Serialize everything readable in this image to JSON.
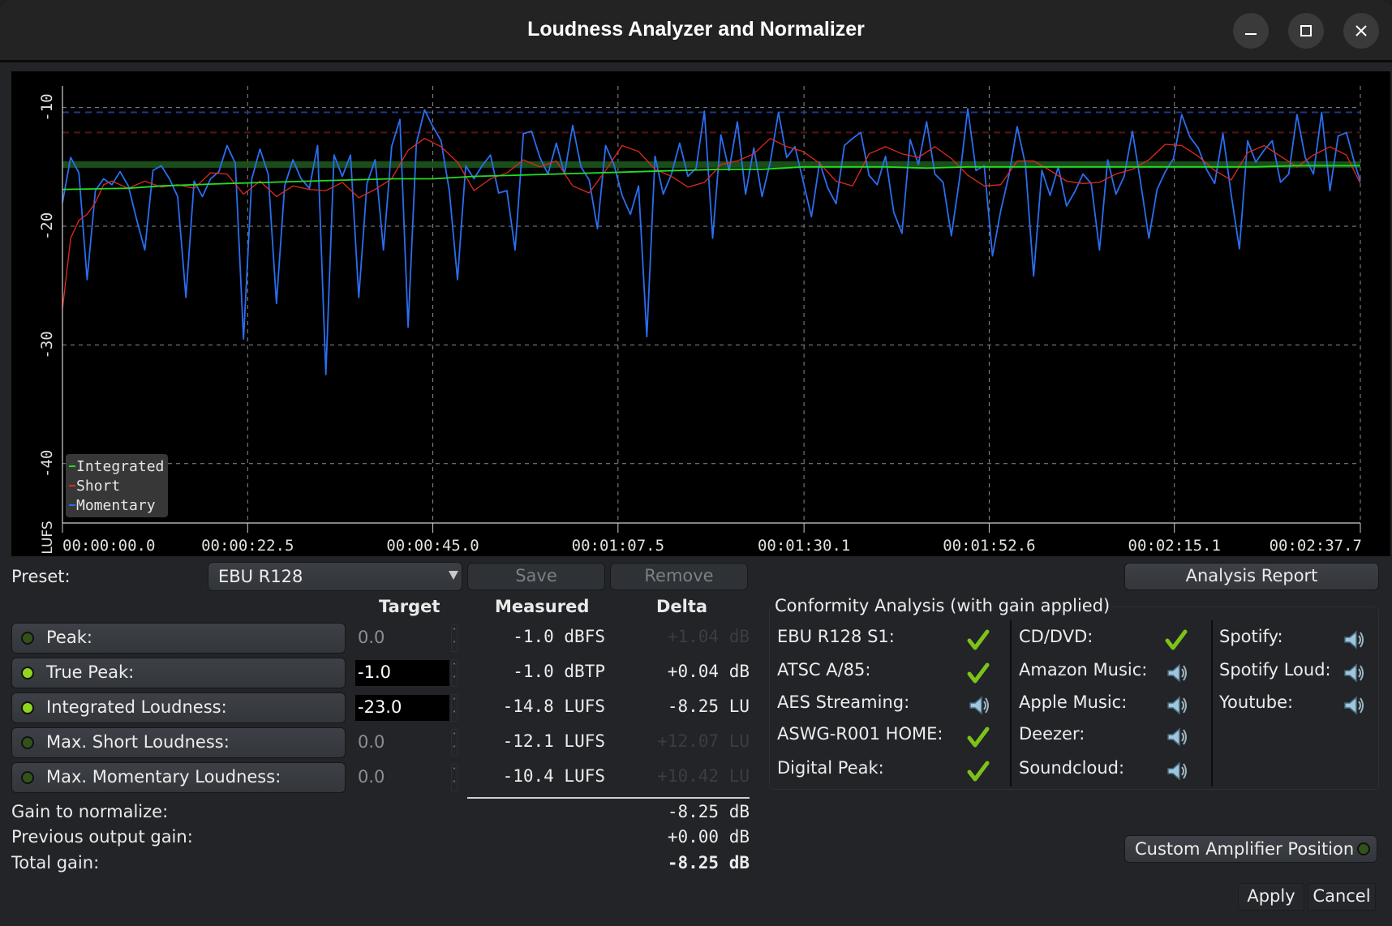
{
  "window": {
    "title": "Loudness Analyzer and Normalizer",
    "controls": [
      "minimize",
      "maximize",
      "close"
    ]
  },
  "chart_data": {
    "type": "line",
    "title": "",
    "ylabel": "LUFS",
    "xlabel": "",
    "ylim": [
      -45,
      -9
    ],
    "yticks": [
      -10,
      -20,
      -30,
      -40
    ],
    "ytick_labels": [
      "-10",
      "-20",
      "-30",
      "-40"
    ],
    "xlim_seconds": [
      0,
      157.7
    ],
    "xticks_seconds": [
      0,
      22.5,
      45.0,
      67.5,
      90.1,
      112.6,
      135.1,
      157.7
    ],
    "xtick_labels": [
      "00:00:00.0",
      "00:00:22.5",
      "00:00:45.0",
      "00:01:07.5",
      "00:01:30.1",
      "00:01:52.6",
      "00:02:15.1",
      "00:02:37.7"
    ],
    "grid": true,
    "legend": {
      "position": "bottom-left",
      "entries": [
        "Integrated",
        "Short",
        "Momentary"
      ]
    },
    "reference_lines": [
      {
        "name": "Max Momentary",
        "value": -10.4,
        "color": "#1a3a8a",
        "style": "dashed"
      },
      {
        "name": "Max Short",
        "value": -12.1,
        "color": "#5a1414",
        "style": "dashed"
      },
      {
        "name": "Integrated measured band",
        "value": -14.8,
        "color": "#1f5a1f",
        "style": "band"
      }
    ],
    "series": [
      {
        "name": "Integrated",
        "color": "#22dd22",
        "x": [
          0,
          8,
          12,
          16,
          20,
          25,
          30,
          35,
          40,
          45,
          50,
          55,
          60,
          65,
          70,
          75,
          80,
          85,
          90,
          95,
          100,
          105,
          110,
          115,
          120,
          125,
          130,
          135,
          140,
          145,
          150,
          157.7
        ],
        "values": [
          -16.9,
          -16.8,
          -16.6,
          -16.5,
          -16.4,
          -16.3,
          -16.2,
          -16.1,
          -16.0,
          -16.0,
          -15.8,
          -15.7,
          -15.6,
          -15.5,
          -15.4,
          -15.3,
          -15.2,
          -15.2,
          -15.0,
          -15.0,
          -15.0,
          -15.1,
          -15.0,
          -15.0,
          -15.0,
          -15.0,
          -15.0,
          -15.0,
          -15.0,
          -15.0,
          -14.9,
          -14.9
        ]
      },
      {
        "name": "Short",
        "color": "#e02a1a",
        "x": [
          0,
          1,
          2,
          3,
          4,
          5,
          6,
          8,
          10,
          12,
          14,
          16,
          18,
          20,
          22,
          24,
          26,
          28,
          30,
          32,
          34,
          36,
          38,
          40,
          42,
          44,
          46,
          48,
          50,
          52,
          54,
          56,
          58,
          60,
          62,
          64,
          66,
          68,
          70,
          72,
          74,
          76,
          78,
          80,
          82,
          84,
          86,
          88,
          90,
          92,
          94,
          96,
          98,
          100,
          102,
          104,
          106,
          108,
          110,
          112,
          114,
          116,
          118,
          120,
          122,
          124,
          126,
          128,
          130,
          132,
          134,
          136,
          138,
          140,
          142,
          144,
          146,
          148,
          150,
          152,
          154,
          156,
          157.7
        ],
        "values": [
          -27,
          -21,
          -19.5,
          -19,
          -18,
          -16.5,
          -16.2,
          -16.8,
          -16.2,
          -16.7,
          -16.5,
          -16.8,
          -15.5,
          -15.6,
          -17.3,
          -16.2,
          -17.5,
          -16.6,
          -16.9,
          -17.0,
          -16.3,
          -17.6,
          -16.9,
          -16.0,
          -13.6,
          -12.6,
          -13.3,
          -14.6,
          -17.0,
          -16.0,
          -15.5,
          -14.4,
          -15.0,
          -14.5,
          -16.6,
          -17.2,
          -15.3,
          -13.2,
          -13.7,
          -15.2,
          -15.8,
          -16.7,
          -16.3,
          -14.8,
          -14.5,
          -13.9,
          -12.6,
          -13.3,
          -13.7,
          -14.7,
          -16.2,
          -16.6,
          -13.9,
          -13.3,
          -13.9,
          -14.2,
          -13.3,
          -14.3,
          -15.7,
          -16.6,
          -16.5,
          -14.5,
          -14.5,
          -15.3,
          -16.2,
          -16.4,
          -16.3,
          -15.6,
          -15.2,
          -14.4,
          -13.1,
          -13.2,
          -14.1,
          -15.3,
          -16.1,
          -13.8,
          -13.2,
          -14.1,
          -15.0,
          -14.0,
          -13.3,
          -14.0,
          -16.4
        ]
      },
      {
        "name": "Momentary",
        "color": "#2a6ef0",
        "x": [
          0,
          1,
          2,
          3,
          4,
          5,
          6,
          7,
          8,
          9,
          10,
          11,
          12,
          13,
          14,
          15,
          16,
          17,
          18,
          19,
          20,
          21,
          22,
          23,
          24,
          25,
          26,
          27,
          28,
          29,
          30,
          31,
          32,
          33,
          34,
          35,
          36,
          37,
          38,
          39,
          40,
          41,
          42,
          43,
          44,
          45,
          46,
          47,
          48,
          49,
          50,
          51,
          52,
          53,
          54,
          55,
          56,
          57,
          58,
          59,
          60,
          61,
          62,
          63,
          64,
          65,
          66,
          67,
          68,
          69,
          70,
          71,
          72,
          73,
          74,
          75,
          76,
          77,
          78,
          79,
          80,
          81,
          82,
          83,
          84,
          85,
          86,
          87,
          88,
          89,
          90,
          91,
          92,
          93,
          94,
          95,
          96,
          97,
          98,
          99,
          100,
          101,
          102,
          103,
          104,
          105,
          106,
          107,
          108,
          109,
          110,
          111,
          112,
          113,
          114,
          115,
          116,
          117,
          118,
          119,
          120,
          121,
          122,
          123,
          124,
          125,
          126,
          127,
          128,
          129,
          130,
          131,
          132,
          133,
          134,
          135,
          136,
          137,
          138,
          139,
          140,
          141,
          142,
          143,
          144,
          145,
          146,
          147,
          148,
          149,
          150,
          151,
          152,
          153,
          154,
          155,
          156,
          157,
          157.7
        ],
        "values": [
          -18,
          -14.2,
          -15.5,
          -24.5,
          -17.0,
          -16.0,
          -16.5,
          -15.4,
          -16.6,
          -19.4,
          -22.0,
          -15.3,
          -14.9,
          -16.0,
          -17.5,
          -26.0,
          -16.2,
          -17.5,
          -16.0,
          -15.4,
          -13.2,
          -14.7,
          -29.5,
          -16.0,
          -13.5,
          -15.6,
          -26.5,
          -16.6,
          -14.4,
          -16.0,
          -16.8,
          -13.2,
          -32.5,
          -14.0,
          -15.8,
          -14.0,
          -26.0,
          -16.4,
          -14.4,
          -22.0,
          -13.3,
          -11.0,
          -28.5,
          -13.0,
          -10.2,
          -11.6,
          -12.8,
          -17.0,
          -24.5,
          -14.9,
          -16.0,
          -14.9,
          -14.0,
          -17.2,
          -17.0,
          -22.0,
          -12.2,
          -12.0,
          -14.2,
          -15.6,
          -13.0,
          -15.6,
          -11.5,
          -15.0,
          -16.1,
          -20.2,
          -13.2,
          -14.8,
          -17.4,
          -19.0,
          -16.6,
          -29.3,
          -14.1,
          -17.3,
          -15.6,
          -13.0,
          -15.8,
          -15.1,
          -10.3,
          -21.0,
          -12.3,
          -15.3,
          -11.2,
          -17.3,
          -13.4,
          -17.5,
          -14.6,
          -10.4,
          -14.2,
          -13.3,
          -16.2,
          -19.2,
          -14.6,
          -16.8,
          -18.1,
          -13.2,
          -12.6,
          -12.1,
          -15.7,
          -16.5,
          -14.1,
          -18.8,
          -20.6,
          -12.7,
          -14.8,
          -11.2,
          -15.6,
          -16.3,
          -20.8,
          -16.0,
          -10.1,
          -15.3,
          -14.9,
          -22.5,
          -18.7,
          -15.7,
          -11.6,
          -14.8,
          -24.2,
          -15.3,
          -17.4,
          -15.0,
          -18.3,
          -17.1,
          -15.6,
          -16.4,
          -22.0,
          -14.4,
          -17.3,
          -15.8,
          -12.0,
          -16.3,
          -21.0,
          -16.9,
          -15.4,
          -14.3,
          -10.6,
          -12.5,
          -13.4,
          -15.2,
          -16.4,
          -12.2,
          -17.3,
          -21.9,
          -12.8,
          -14.6,
          -13.6,
          -12.8,
          -16.3,
          -15.6,
          -10.6,
          -14.2,
          -15.6,
          -10.4,
          -17.0,
          -12.4,
          -12.1,
          -14.7,
          -16.2,
          -17.8,
          -18.0,
          -19.6,
          -21.0
        ]
      }
    ]
  },
  "preset": {
    "label": "Preset:",
    "selected": "EBU R128",
    "save_label": "Save",
    "remove_label": "Remove",
    "analysis_report_label": "Analysis Report"
  },
  "table": {
    "headers": {
      "target": "Target",
      "measured": "Measured",
      "delta": "Delta"
    },
    "rows": [
      {
        "label": "Peak:",
        "enabled": false,
        "target": "0.0",
        "measured": "-1.0 dBFS",
        "delta": "+1.04 dB",
        "delta_active": false
      },
      {
        "label": "True Peak:",
        "enabled": true,
        "target": "-1.0",
        "measured": "-1.0 dBTP",
        "delta": "+0.04 dB",
        "delta_active": true
      },
      {
        "label": "Integrated Loudness:",
        "enabled": true,
        "target": "-23.0",
        "measured": "-14.8 LUFS",
        "delta": "-8.25 LU",
        "delta_active": true
      },
      {
        "label": "Max. Short Loudness:",
        "enabled": false,
        "target": "0.0",
        "measured": "-12.1 LUFS",
        "delta": "+12.07 LU",
        "delta_active": false
      },
      {
        "label": "Max. Momentary Loudness:",
        "enabled": false,
        "target": "0.0",
        "measured": "-10.4 LUFS",
        "delta": "+10.42 LU",
        "delta_active": false
      }
    ]
  },
  "gain": {
    "normalize_label": "Gain to normalize:",
    "normalize_value": "-8.25 dB",
    "previous_label": "Previous output gain:",
    "previous_value": "+0.00 dB",
    "total_label": "Total gain:",
    "total_value": "-8.25 dB"
  },
  "conformity": {
    "title": "Conformity Analysis (with gain applied)",
    "columns": [
      [
        {
          "label": "EBU R128 S1:",
          "status": "pass"
        },
        {
          "label": "ATSC A/85:",
          "status": "pass"
        },
        {
          "label": "AES Streaming:",
          "status": "fail"
        },
        {
          "label": "ASWG-R001 HOME:",
          "status": "pass"
        },
        {
          "label": "Digital Peak:",
          "status": "pass"
        }
      ],
      [
        {
          "label": "CD/DVD:",
          "status": "pass"
        },
        {
          "label": "Amazon Music:",
          "status": "fail"
        },
        {
          "label": "Apple Music:",
          "status": "fail"
        },
        {
          "label": "Deezer:",
          "status": "fail"
        },
        {
          "label": "Soundcloud:",
          "status": "fail"
        }
      ],
      [
        {
          "label": "Spotify:",
          "status": "fail"
        },
        {
          "label": "Spotify Loud:",
          "status": "fail"
        },
        {
          "label": "Youtube:",
          "status": "fail"
        }
      ]
    ],
    "status_icons": {
      "pass": "check-icon",
      "fail": "speaker-icon"
    }
  },
  "amplifier": {
    "label": "Custom Amplifier Position",
    "enabled": false
  },
  "footer": {
    "apply_label": "Apply",
    "cancel_label": "Cancel"
  },
  "colors": {
    "led_on": "#8fd61d",
    "led_off": "#33521a",
    "pass": "#7cc21a"
  }
}
